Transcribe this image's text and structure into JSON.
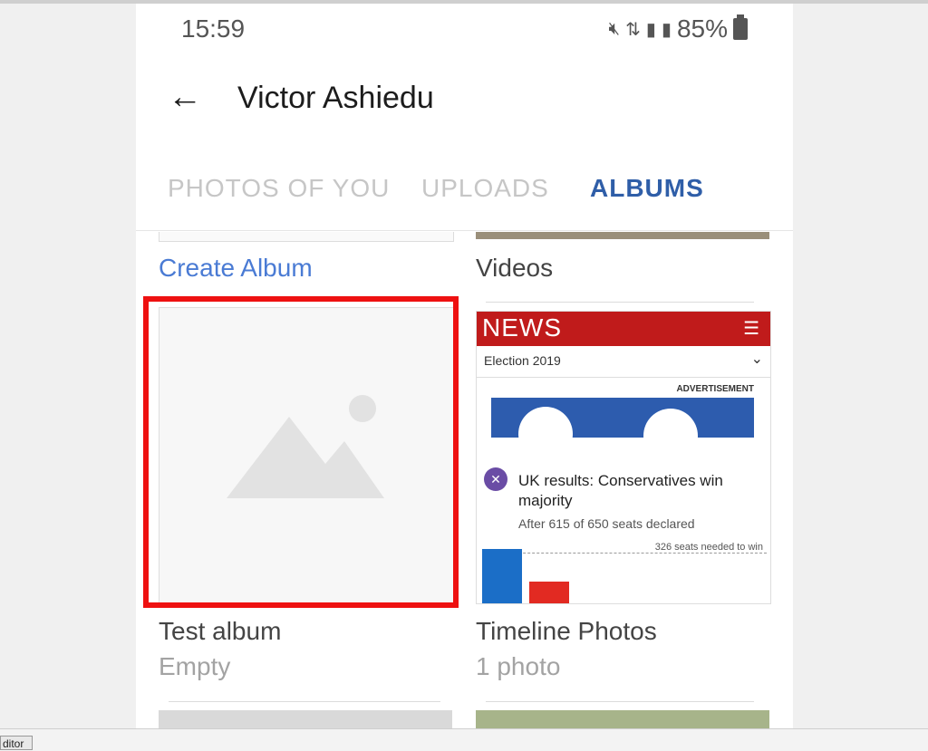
{
  "status_bar": {
    "time": "15:59",
    "battery_percent": "85%",
    "icons": [
      "mute-icon",
      "network-hplus-icon",
      "signal-icon",
      "signal-roaming-icon",
      "battery-icon"
    ]
  },
  "header": {
    "back_icon": "arrow-left-icon",
    "title": "Victor Ashiedu"
  },
  "tabs": [
    {
      "label": "PHOTOS OF YOU",
      "active": false
    },
    {
      "label": "UPLOADS",
      "active": false
    },
    {
      "label": "ALBUMS",
      "active": true
    }
  ],
  "albums": {
    "create_label": "Create Album",
    "videos_label": "Videos",
    "items": [
      {
        "title": "Test album",
        "subtitle": "Empty",
        "thumbnail": "placeholder-image-icon"
      },
      {
        "title": "Timeline Photos",
        "subtitle": "1 photo"
      }
    ]
  },
  "news_thumbnail": {
    "logo": "NEWS",
    "section": "Election 2019",
    "advertisement": "ADVERTISEMENT",
    "headline": "UK results: Conservatives win majority",
    "declared": "After 615 of 650 seats declared",
    "needed": "326 seats needed to win"
  },
  "footer": {
    "tab_label": "ditor"
  },
  "colors": {
    "accent": "#2f5ea8",
    "link": "#4a7bd4",
    "highlight": "#ee1111",
    "news_red": "#c01b1b"
  }
}
